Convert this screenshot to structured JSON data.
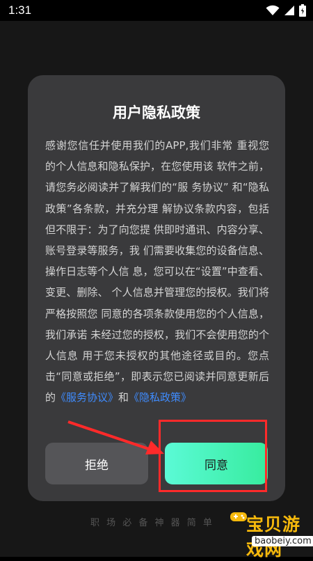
{
  "status_bar": {
    "time": "1:31"
  },
  "background": {
    "slogan": "职 场 必 备 神 器   简 单"
  },
  "dialog": {
    "title": "用户隐私政策",
    "body_text": "感谢您信任并使用我们的APP,我们非常 重视您的个人信息和隐私保护，在您使用该 软件之前，请您务必阅读并了解我们的“服 务协议” 和“隐私政策”各条款，并充分理 解协议条款内容，包括但不限于：为了向您提 供即时通讯、内容分享、账号登录等服务，我 们需要收集您的设备信息、操作日志等个人信 息，您可以在“设置”中查看、变更、删除、 个人信息并管理您的授权。我们将严格按照您 同意的各项条款使用您的个人信息，我们承诺 未经过您的授权，我们不会使用您的个人信息 用于您未授权的其他途径或目的。您点击“同意或拒绝”，即表示您已阅读并同意更新后的",
    "link_service": "《服务协议》",
    "and_text": "和",
    "link_privacy": "《隐私政策》",
    "refuse_label": "拒绝",
    "agree_label": "同意"
  },
  "annotation": {
    "highlight_color": "#ff2a2a"
  },
  "watermark": {
    "brand": "宝贝游戏网",
    "domain": "baobeiy.com"
  },
  "colors": {
    "dialog_bg": "#3a3a3c",
    "agree_gradient_start": "#5bfad6",
    "agree_gradient_end": "#37ec9e",
    "link": "#3f8cff"
  },
  "icons": [
    "wifi-icon",
    "cellular-signal-icon",
    "battery-icon",
    "gamepad-logo-icon",
    "arrow-icon"
  ]
}
